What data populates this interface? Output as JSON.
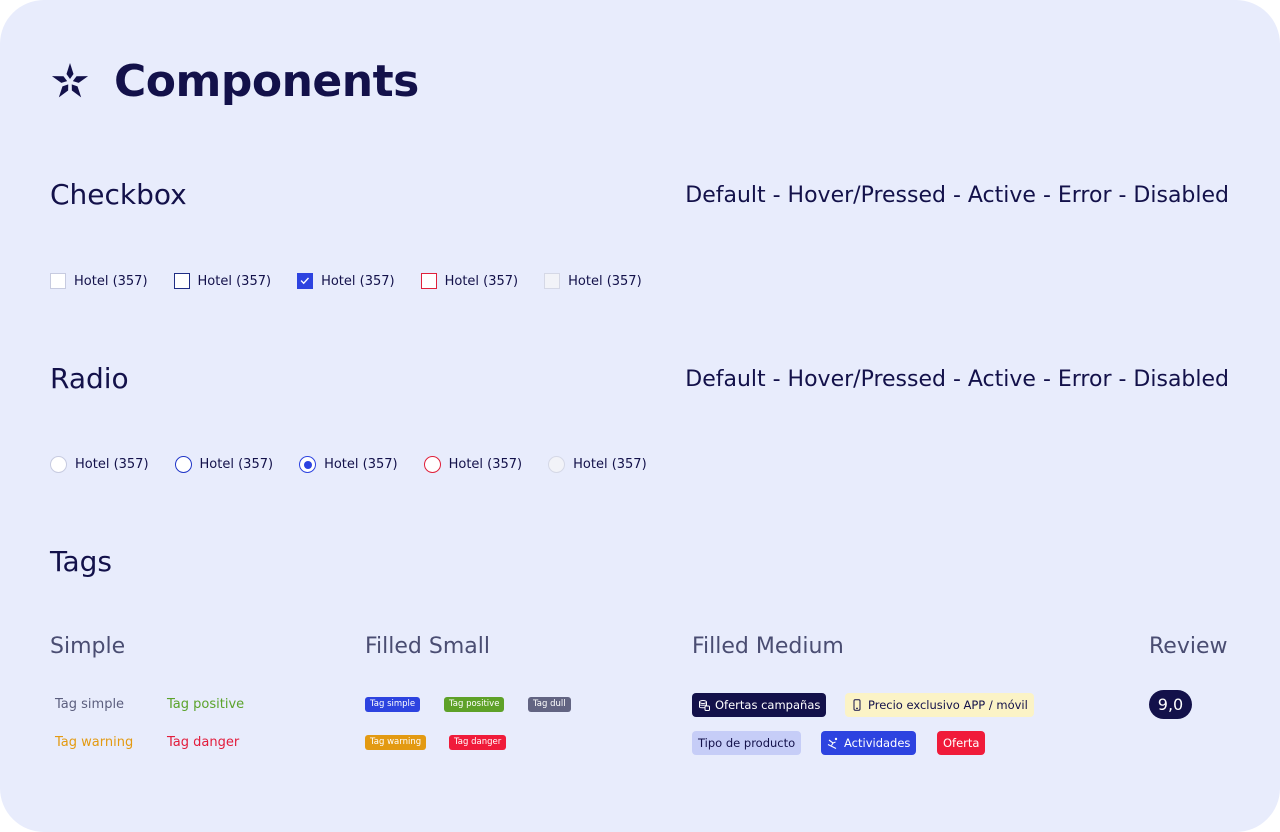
{
  "page": {
    "title": "Components"
  },
  "checkbox": {
    "title": "Checkbox",
    "states_label": "Default - Hover/Pressed -  Active - Error - Disabled",
    "items": [
      {
        "label": "Hotel (357)",
        "state": "default"
      },
      {
        "label": "Hotel (357)",
        "state": "hover"
      },
      {
        "label": "Hotel (357)",
        "state": "active"
      },
      {
        "label": "Hotel (357)",
        "state": "error"
      },
      {
        "label": "Hotel (357)",
        "state": "disabled"
      }
    ]
  },
  "radio": {
    "title": "Radio",
    "states_label": "Default - Hover/Pressed -  Active - Error - Disabled",
    "items": [
      {
        "label": "Hotel (357)",
        "state": "default"
      },
      {
        "label": "Hotel (357)",
        "state": "hover"
      },
      {
        "label": "Hotel (357)",
        "state": "active"
      },
      {
        "label": "Hotel (357)",
        "state": "error"
      },
      {
        "label": "Hotel (357)",
        "state": "disabled"
      }
    ]
  },
  "tags": {
    "title": "Tags",
    "simple": {
      "title": "Simple",
      "items": [
        {
          "label": "Tag simple",
          "color": "#5b5e7e"
        },
        {
          "label": "Tag positive",
          "color": "#5ba32b"
        },
        {
          "label": "Tag warning",
          "color": "#e39a12"
        },
        {
          "label": "Tag danger",
          "color": "#e21d3c"
        }
      ]
    },
    "filled_small": {
      "title": "Filled Small",
      "items": [
        {
          "label": "Tag simple",
          "color": "#2d43e0"
        },
        {
          "label": "Tag positive",
          "color": "#5ea128"
        },
        {
          "label": "Tag dull",
          "color": "#626482"
        },
        {
          "label": "Tag warning",
          "color": "#e39a12"
        },
        {
          "label": "Tag danger",
          "color": "#f01b3a"
        }
      ]
    },
    "filled_medium": {
      "title": "Filled Medium",
      "items": [
        {
          "label": "Ofertas campañas",
          "icon": "coins-icon",
          "bg": "#13114a",
          "fg": "#ffffff"
        },
        {
          "label": "Precio exclusivo APP / móvil",
          "icon": "mobile-phone-icon",
          "bg": "#fbf3c6",
          "fg": "#13114a"
        },
        {
          "label": "Tipo de producto",
          "bg": "#c6cdf7",
          "fg": "#13114a"
        },
        {
          "label": "Actividades",
          "icon": "ski-icon",
          "bg": "#2d43e0",
          "fg": "#ffffff"
        },
        {
          "label": "Oferta",
          "bg": "#f01b3a",
          "fg": "#ffffff"
        }
      ]
    },
    "review": {
      "title": "Review",
      "score": "9,0"
    }
  }
}
